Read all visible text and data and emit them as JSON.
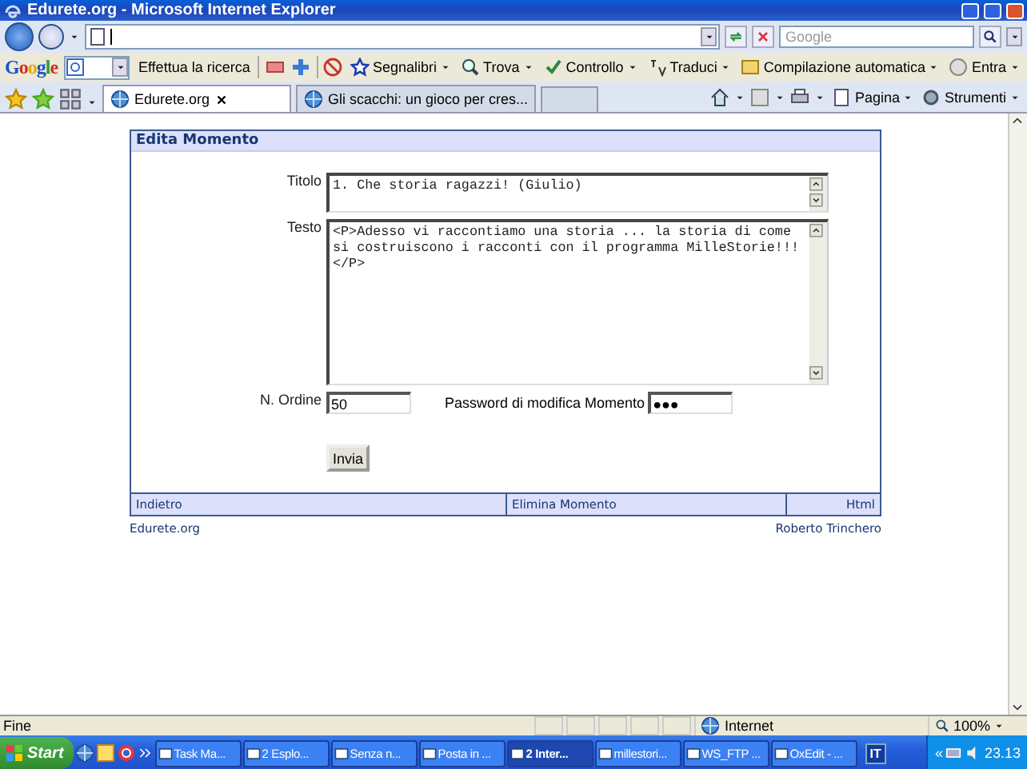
{
  "window": {
    "title": "Edurete.org - Microsoft Internet Explorer"
  },
  "search": {
    "placeholder": "Google"
  },
  "google_toolbar": {
    "brand": "Google",
    "search_button": "Effettua la ricerca",
    "items": [
      {
        "label": "Segnalibri"
      },
      {
        "label": "Trova"
      },
      {
        "label": "Controllo"
      },
      {
        "label": "Traduci"
      },
      {
        "label": "Compilazione automatica"
      },
      {
        "label": "Entra"
      }
    ]
  },
  "tabs": [
    {
      "label": "Edurete.org",
      "selected": true
    },
    {
      "label": "Gli scacchi: un gioco per cres...",
      "selected": false
    }
  ],
  "command_bar": [
    {
      "label": "Pagina"
    },
    {
      "label": "Strumenti"
    }
  ],
  "page": {
    "heading": "Edita Momento",
    "fields": [
      {
        "label": "Titolo",
        "value": "1. Che storia ragazzi! (Giulio)"
      },
      {
        "label": "Testo",
        "value": "<P>Adesso vi raccontiamo una storia ... la storia di come si costruiscono i racconti con il programma MilleStorie!!!\n</P>"
      }
    ],
    "order": {
      "label": "N. Ordine",
      "value": "50"
    },
    "password": {
      "label": "Password di modifica Momento",
      "value": "●●●"
    },
    "submit": "Invia",
    "footer_links": [
      "Indietro",
      "Elimina Momento",
      "Html"
    ],
    "credits": [
      "Edurete.org",
      "Roberto Trinchero"
    ]
  },
  "status_bar": {
    "text": "Fine",
    "zone": "Internet",
    "zoom": "100%"
  },
  "taskbar": {
    "start": "Start",
    "tasks": [
      {
        "label": "Task Ma...",
        "selected": false
      },
      {
        "label": "2 Esplo...",
        "selected": false
      },
      {
        "label": "Senza n...",
        "selected": false
      },
      {
        "label": "Posta in ...",
        "selected": false
      },
      {
        "label": "2 Inter...",
        "selected": true
      },
      {
        "label": "millestori...",
        "selected": false
      },
      {
        "label": "WS_FTP ...",
        "selected": false
      },
      {
        "label": "OxEdit - ...",
        "selected": false
      }
    ],
    "language": "IT",
    "tray_expander": "«",
    "clock": "23.13"
  }
}
